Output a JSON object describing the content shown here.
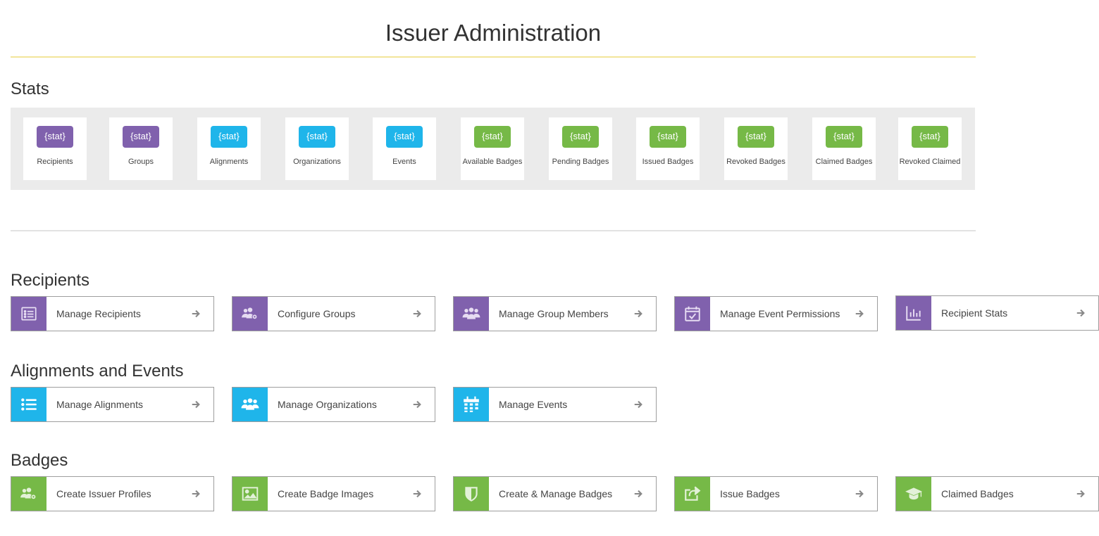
{
  "page_title": "Issuer Administration",
  "colors": {
    "purple": "#8061ad",
    "blue": "#1fb5ea",
    "green": "#76b947",
    "title_rule": "#f2e59a"
  },
  "stats": {
    "heading": "Stats",
    "items": [
      {
        "value": "{stat}",
        "label": "Recipients",
        "color": "purple"
      },
      {
        "value": "{stat}",
        "label": "Groups",
        "color": "purple"
      },
      {
        "value": "{stat}",
        "label": "Alignments",
        "color": "blue"
      },
      {
        "value": "{stat}",
        "label": "Organizations",
        "color": "blue"
      },
      {
        "value": "{stat}",
        "label": "Events",
        "color": "blue"
      },
      {
        "value": "{stat}",
        "label": "Available Badges",
        "color": "green"
      },
      {
        "value": "{stat}",
        "label": "Pending Badges",
        "color": "green"
      },
      {
        "value": "{stat}",
        "label": "Issued Badges",
        "color": "green"
      },
      {
        "value": "{stat}",
        "label": "Revoked Badges",
        "color": "green"
      },
      {
        "value": "{stat}",
        "label": "Claimed Badges",
        "color": "green"
      },
      {
        "value": "{stat}",
        "label": "Revoked Claimed",
        "color": "green"
      }
    ]
  },
  "recipients": {
    "heading": "Recipients",
    "items": [
      {
        "label": "Manage Recipients",
        "icon": "list-card-icon"
      },
      {
        "label": "Configure Groups",
        "icon": "users-gear-icon"
      },
      {
        "label": "Manage Group Members",
        "icon": "users-icon"
      },
      {
        "label": "Manage Event Permissions",
        "icon": "calendar-check-icon"
      },
      {
        "label": "Recipient Stats",
        "icon": "bar-chart-icon"
      }
    ]
  },
  "alignments": {
    "heading": "Alignments and Events",
    "items": [
      {
        "label": "Manage Alignments",
        "icon": "list-icon"
      },
      {
        "label": "Manage Organizations",
        "icon": "users-icon"
      },
      {
        "label": "Manage Events",
        "icon": "calendar-icon"
      }
    ]
  },
  "badges": {
    "heading": "Badges",
    "items": [
      {
        "label": "Create Issuer Profiles",
        "icon": "users-gear-icon"
      },
      {
        "label": "Create Badge Images",
        "icon": "image-icon"
      },
      {
        "label": "Create & Manage Badges",
        "icon": "shield-icon"
      },
      {
        "label": "Issue Badges",
        "icon": "share-icon"
      },
      {
        "label": "Claimed Badges",
        "icon": "graduation-cap-icon"
      }
    ]
  }
}
